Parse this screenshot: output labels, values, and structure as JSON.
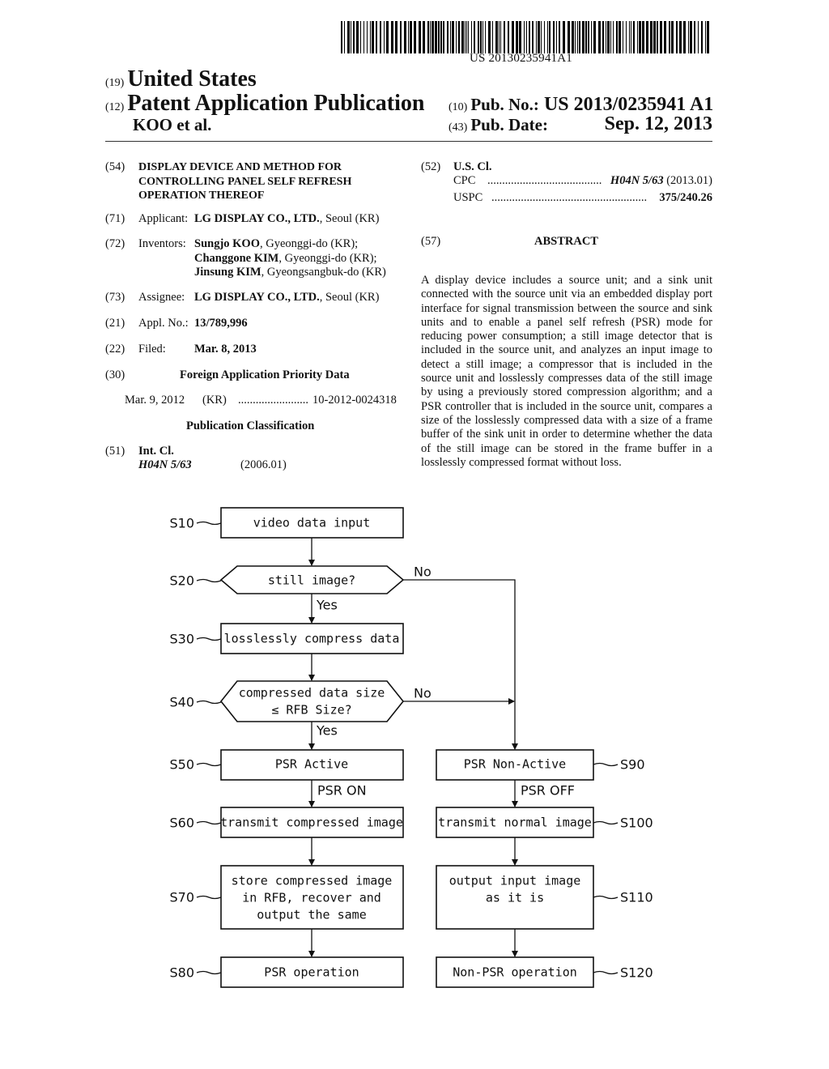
{
  "header": {
    "barcode_number": "US 20130235941A1",
    "country_code": "(19)",
    "country": "United States",
    "doc_type_code": "(12)",
    "doc_type": "Patent Application Publication",
    "authors": "KOO et al.",
    "pub_no_code": "(10)",
    "pub_no_label": "Pub. No.:",
    "pub_no": "US 2013/0235941 A1",
    "pub_date_code": "(43)",
    "pub_date_label": "Pub. Date:",
    "pub_date": "Sep. 12, 2013"
  },
  "left_column": {
    "title_code": "(54)",
    "title_lines": [
      "DISPLAY DEVICE AND METHOD FOR",
      "CONTROLLING PANEL SELF REFRESH",
      "OPERATION THEREOF"
    ],
    "applicant": {
      "code": "(71)",
      "label": "Applicant:",
      "name": "LG DISPLAY CO., LTD.",
      "location": ", Seoul (KR)"
    },
    "inventors": {
      "code": "(72)",
      "label": "Inventors:",
      "list": [
        {
          "name": "Sungjo KOO",
          "location": ", Gyeonggi-do (KR);"
        },
        {
          "name": "Changgone KIM",
          "location": ", Gyeonggi-do (KR);"
        },
        {
          "name": "Jinsung KIM",
          "location": ", Gyeongsangbuk-do (KR)"
        }
      ]
    },
    "assignee": {
      "code": "(73)",
      "label": "Assignee:",
      "name": "LG DISPLAY CO., LTD.",
      "location": ", Seoul (KR)"
    },
    "appl_no": {
      "code": "(21)",
      "label": "Appl. No.:",
      "value": "13/789,996"
    },
    "filed": {
      "code": "(22)",
      "label": "Filed:",
      "value": "Mar. 8, 2013"
    },
    "foreign_priority": {
      "code": "(30)",
      "heading": "Foreign Application Priority Data",
      "date": "Mar. 9, 2012",
      "country": "(KR)",
      "dots": "........................",
      "number": "10-2012-0024318"
    },
    "pub_class_heading": "Publication Classification",
    "int_cl": {
      "code": "(51)",
      "label": "Int. Cl.",
      "class": "H04N 5/63",
      "version": "(2006.01)"
    }
  },
  "right_column": {
    "us_cl": {
      "code": "(52)",
      "label": "U.S. Cl.",
      "cpc_label": "CPC",
      "cpc_dots": ".......................................",
      "cpc_class": "H04N 5/63",
      "cpc_version": "(2013.01)",
      "uspc_label": "USPC",
      "uspc_dots": ".....................................................",
      "uspc_value": "375/240.26"
    },
    "abstract_code": "(57)",
    "abstract_heading": "ABSTRACT",
    "abstract_text": "A display device includes a source unit; and a sink unit connected with the source unit via an embedded display port interface for signal transmission between the source and sink units and to enable a panel self refresh (PSR) mode for reducing power consumption; a still image detector that is included in the source unit, and analyzes an input image to detect a still image; a compressor that is included in the source unit and losslessly compresses data of the still image by using a previously stored compression algorithm; and a PSR controller that is included in the source unit, compares a size of the losslessly compressed data with a size of a frame buffer of the sink unit in order to determine whether the data of the still image can be stored in the frame buffer in a losslessly compressed format without loss."
  },
  "flowchart": {
    "steps": {
      "s10": {
        "label": "S10",
        "text": [
          "video data input"
        ]
      },
      "s20": {
        "label": "S20",
        "text": [
          "still image?"
        ]
      },
      "s30": {
        "label": "S30",
        "text": [
          "losslessly compress data"
        ]
      },
      "s40": {
        "label": "S40",
        "text": [
          "compressed data size",
          "≤ RFB Size?"
        ]
      },
      "s50": {
        "label": "S50",
        "text": [
          "PSR Active"
        ]
      },
      "s60": {
        "label": "S60",
        "text": [
          "transmit compressed image"
        ]
      },
      "s70": {
        "label": "S70",
        "text": [
          "store compressed image",
          "in RFB, recover and",
          "output the same"
        ]
      },
      "s80": {
        "label": "S80",
        "text": [
          "PSR operation"
        ]
      },
      "s90": {
        "label": "S90",
        "text": [
          "PSR Non-Active"
        ]
      },
      "s100": {
        "label": "S100",
        "text": [
          "transmit normal image"
        ]
      },
      "s110": {
        "label": "S110",
        "text": [
          "output input image",
          "as it is"
        ]
      },
      "s120": {
        "label": "S120",
        "text": [
          "Non-PSR operation"
        ]
      }
    },
    "edge_labels": {
      "s20_yes": "Yes",
      "s20_no": "No",
      "s40_yes": "Yes",
      "s40_no": "No",
      "psr_on": "PSR ON",
      "psr_off": "PSR OFF"
    }
  }
}
